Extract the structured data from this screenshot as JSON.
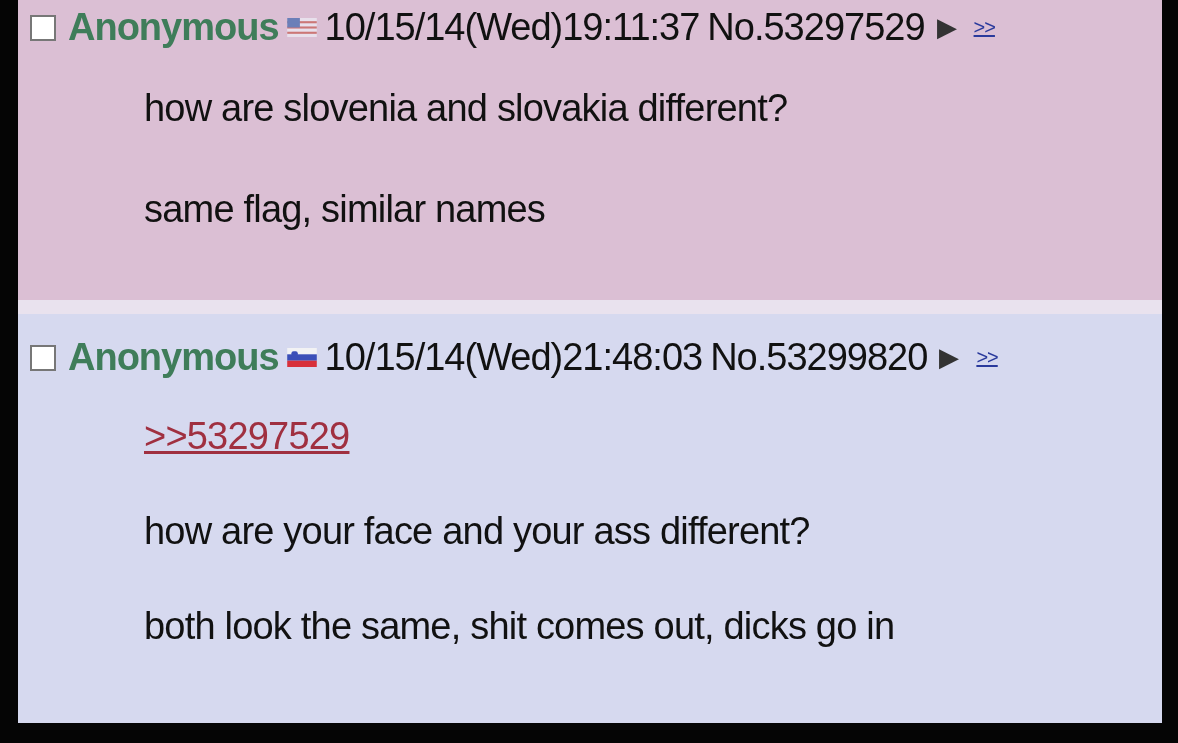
{
  "posts": [
    {
      "selected": false,
      "name": "Anonymous",
      "datetime": "10/15/14(Wed)19:11:37",
      "number": "No.53297529",
      "menu_glyph": "▶",
      "backlink": ">>",
      "lines": [
        "how are slovenia and slovakia different?",
        "same flag, similar names"
      ]
    },
    {
      "selected": false,
      "name": "Anonymous",
      "datetime": "10/15/14(Wed)21:48:03",
      "number": "No.53299820",
      "menu_glyph": "▶",
      "backlink": ">>",
      "reply_link": ">>53297529",
      "lines": [
        "how are your face and your ass different?",
        "both look the same, shit comes out, dicks go in"
      ]
    }
  ]
}
